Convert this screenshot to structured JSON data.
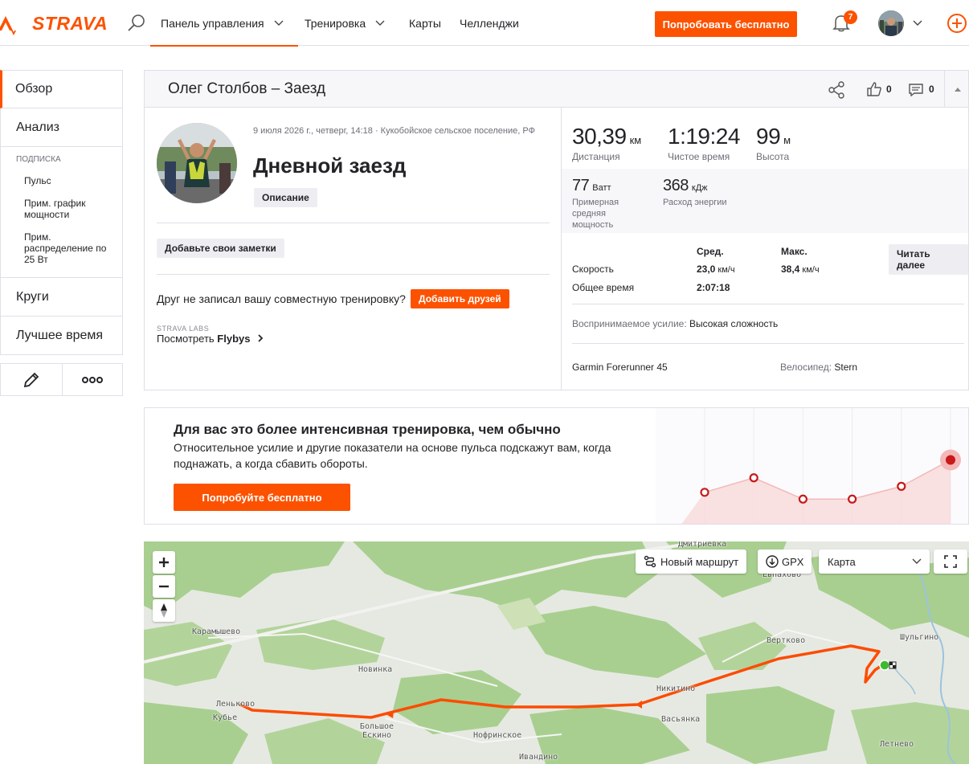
{
  "brand": {
    "name": "STRAVA",
    "accent": "#fc5200"
  },
  "nav": {
    "items": [
      {
        "label": "Панель управления",
        "has_dropdown": true,
        "active": true
      },
      {
        "label": "Тренировка",
        "has_dropdown": true,
        "active": false
      },
      {
        "label": "Карты",
        "has_dropdown": false,
        "active": false
      },
      {
        "label": "Челленджи",
        "has_dropdown": false,
        "active": false
      }
    ],
    "try_label": "Попробовать бесплатно",
    "notifications": "7",
    "icons": [
      "search-icon",
      "bell-icon",
      "chevron-down-icon",
      "plus-circle-icon"
    ]
  },
  "sidebar": {
    "items": [
      "Обзор",
      "Анализ"
    ],
    "subscription_caption": "ПОДПИСКА",
    "sub_items": [
      "Пульс",
      "Прим. график мощности",
      "Прим. распределение по 25 Вт"
    ],
    "bottom_items": [
      "Круги",
      "Лучшее время"
    ],
    "tools": [
      "pencil-icon",
      "more-dots-icon"
    ]
  },
  "activity": {
    "header_title": "Олег Столбов – Заезд",
    "likes": "0",
    "comments": "0",
    "meta": "9 июля 2026 г., четверг, 14:18 · Кукобойское сельское поселение, РФ",
    "name": "Дневной заезд",
    "description_label": "Описание",
    "notes_label": "Добавьте свои заметки",
    "friend_text": "Друг не записал вашу совместную тренировку?",
    "friend_button": "Добавить друзей",
    "labs_caption": "STRAVA LABS",
    "flybys_prefix": "Посмотреть",
    "flybys_name": "Flybys",
    "stats": {
      "distance": {
        "value": "30,39",
        "unit": "км",
        "label": "Дистанция"
      },
      "moving_time": {
        "value": "1:19:24",
        "unit": "",
        "label": "Чистое время"
      },
      "elevation": {
        "value": "99",
        "unit": "м",
        "label": "Высота"
      },
      "power": {
        "value": "77",
        "unit": "Ватт",
        "label": "Примерная средняя мощность"
      },
      "energy": {
        "value": "368",
        "unit": "кДж",
        "label": "Расход энергии"
      }
    },
    "table": {
      "col_avg": "Сред.",
      "col_max": "Макс.",
      "rows": [
        {
          "label": "Скорость",
          "avg": "23,0",
          "avg_unit": "км/ч",
          "max": "38,4",
          "max_unit": "км/ч"
        },
        {
          "label": "Общее время",
          "avg": "2:07:18",
          "avg_unit": "",
          "max": "",
          "max_unit": ""
        }
      ],
      "read_more": "Читать далее"
    },
    "effort_label": "Воспринимаемое усилие:",
    "effort_value": "Высокая сложность",
    "device": "Garmin Forerunner 45",
    "bike_label": "Велосипед:",
    "bike_value": "Stern"
  },
  "upsell": {
    "title": "Для вас это более интенсивная тренировка, чем обычно",
    "text": "Относительное усилие и другие показатели на основе пульса подскажут вам, когда поднажать, а когда сбавить обороты.",
    "button": "Попробуйте бесплатно",
    "trend": [
      0.2,
      0.37,
      0.12,
      0.12,
      0.27,
      0.58
    ]
  },
  "map": {
    "controls": [
      "zoom-in",
      "zoom-out",
      "compass"
    ],
    "new_route": "Новый маршрут",
    "gpx": "GPX",
    "type_selected": "Карта",
    "places": [
      "Дмитриевка",
      "Евпахово",
      "Карамышево",
      "Новинка",
      "Вертково",
      "Шульгино",
      "Никитино",
      "Васьянка",
      "Леньково",
      "Кубье",
      "Большое Ескино",
      "Нофринское",
      "Ивандино",
      "Летнево"
    ]
  }
}
